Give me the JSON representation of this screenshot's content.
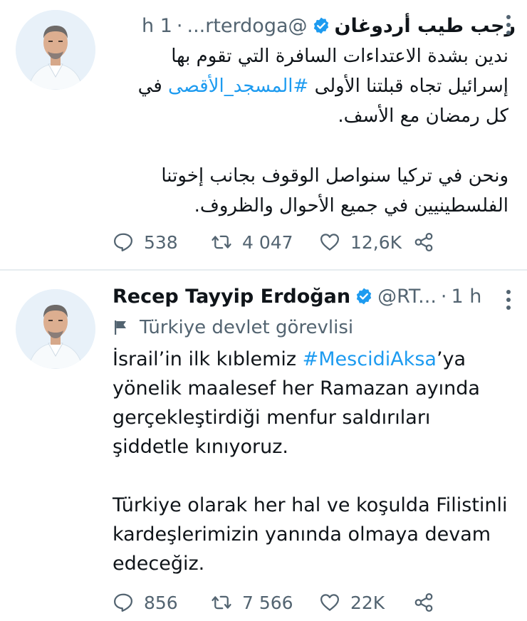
{
  "tweets": [
    {
      "name": "رجب طيب أردوغان",
      "handle": "@rterdoga...",
      "separator": "·",
      "time": "1 h",
      "text_before": "ندين بشدة الاعتداءات السافرة التي تقوم بها إسرائيل تجاه قبلتنا الأولى ",
      "hashtag": "#المسجد_الأقصى",
      "text_after": " في كل رمضان مع الأسف.\n\nونحن في تركيا سنواصل الوقوف بجانب إخوتنا الفلسطينيين في جميع الأحوال والظروف.",
      "stats": {
        "replies": "538",
        "retweets": "4 047",
        "likes": "12,6K"
      }
    },
    {
      "name": "Recep Tayyip Erdoğan",
      "handle": "@RT...",
      "separator": "·",
      "time": "1 h",
      "label": "Türkiye devlet görevlisi",
      "text_before": "İsrail’in ilk kıblemiz ",
      "hashtag": "#MescidiAksa",
      "text_after": "’ya yönelik maalesef her Ramazan ayında gerçekleştirdiği menfur saldırıları şiddetle kınıyoruz.\n\nTürkiye olarak her hal ve koşulda Filistinli kardeşlerimizin yanında olmaya devam edeceğiz.",
      "stats": {
        "replies": "856",
        "retweets": "7 566",
        "likes": "22K"
      }
    }
  ],
  "colors": {
    "accent": "#1d9bf0",
    "secondary_text": "#536471",
    "divider": "#e6ecf0"
  },
  "icons": {
    "verified": "verified-badge-icon",
    "more": "more-vertical-icon",
    "reply": "reply-icon",
    "retweet": "retweet-icon",
    "like": "heart-icon",
    "share": "share-icon",
    "label": "flag-icon"
  }
}
